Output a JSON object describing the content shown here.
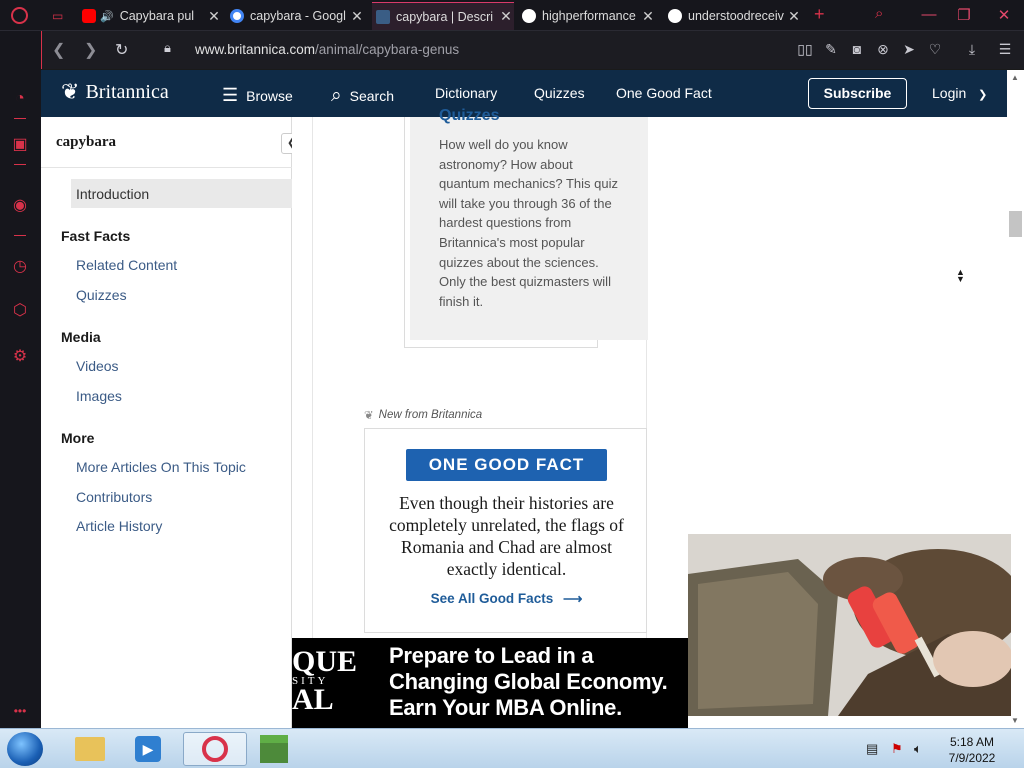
{
  "tabs": [
    {
      "title": "Capybara pul",
      "favicon": "youtube-icon",
      "audio": true,
      "active": false
    },
    {
      "title": "capybara - Googl",
      "favicon": "google-icon",
      "active": false
    },
    {
      "title": "capybara | Descri",
      "favicon": "britannica-icon",
      "active": true
    },
    {
      "title": "highperformance",
      "favicon": "globe-icon",
      "active": false
    },
    {
      "title": "understoodreceiv",
      "favicon": "globe-icon",
      "active": false
    }
  ],
  "address": {
    "domain": "www.britannica.com",
    "path": "/animal/capybara-genus"
  },
  "site": {
    "logo_text": "Britannica",
    "nav": {
      "browse": "Browse",
      "search": "Search",
      "dictionary": "Dictionary",
      "quizzes": "Quizzes",
      "one_good_fact": "One Good Fact"
    },
    "subscribe": "Subscribe",
    "login": "Login"
  },
  "article_sidebar": {
    "title": "capybara",
    "items": {
      "introduction": "Introduction",
      "fast_facts": "Fast Facts",
      "related_content": "Related Content",
      "quizzes": "Quizzes",
      "media": "Media",
      "videos": "Videos",
      "images": "Images",
      "more": "More",
      "more_articles": "More Articles On This Topic",
      "contributors": "Contributors",
      "article_history": "Article History"
    }
  },
  "quiz_card": {
    "title": "Quizzes",
    "body": "How well do you know astronomy? How about quantum mechanics? This quiz will take you through 36 of the hardest questions from Britannica's most popular quizzes about the sciences. Only the best quizmasters will finish it."
  },
  "good_fact": {
    "new_from": "New from Britannica",
    "badge": "ONE GOOD FACT",
    "text": "Even though their histories are completely unrelated, the flags of Romania and Chad are almost exactly identical.",
    "link": "See All Good Facts"
  },
  "ad": {
    "logo_lines": [
      "QUE",
      "SITY",
      "AL"
    ],
    "headline": "Prepare to Lead in a Changing Global Economy. Earn Your MBA Online."
  },
  "taskbar": {
    "time": "5:18 AM",
    "date": "7/9/2022"
  },
  "colors": {
    "britannica_navy": "#0f2b47",
    "link_blue": "#1f5c99",
    "opera_red": "#d8324a",
    "fact_blue": "#1e62b0"
  }
}
